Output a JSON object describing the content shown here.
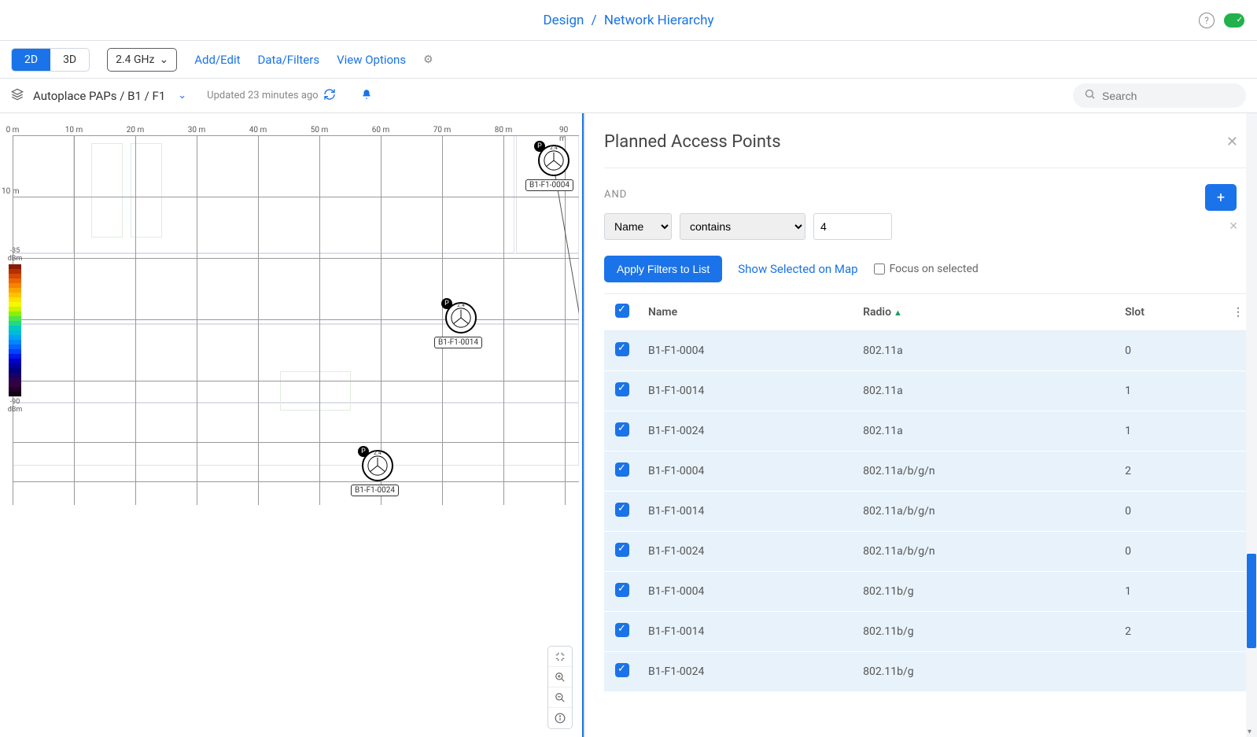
{
  "breadcrumb": {
    "a": "Design",
    "b": "Network Hierarchy"
  },
  "toolbar": {
    "view2d": "2D",
    "view3d": "3D",
    "band": "2.4 GHz",
    "addEdit": "Add/Edit",
    "dataFilters": "Data/Filters",
    "viewOptions": "View Options"
  },
  "subbar": {
    "path": "Autoplace PAPs / B1 / F1",
    "updated": "Updated 23 minutes ago"
  },
  "search": {
    "placeholder": "Search"
  },
  "map": {
    "rulerTop": [
      "0 m",
      "10 m",
      "20 m",
      "30 m",
      "40 m",
      "50 m",
      "60 m",
      "70 m",
      "80 m",
      "90 m"
    ],
    "rulerLeft": [
      "10 m"
    ],
    "legendTop": "-35\ndBm",
    "legendBottom": "-90\ndBm",
    "aps": [
      {
        "label": "B1-F1-0004",
        "band": "2.4"
      },
      {
        "label": "B1-F1-0014",
        "band": "2.4"
      },
      {
        "label": "B1-F1-0024",
        "band": "2.4"
      }
    ]
  },
  "panel": {
    "title": "Planned Access Points",
    "and": "AND",
    "filterField": "Name",
    "filterCond": "contains",
    "filterVal": "4",
    "applyBtn": "Apply Filters to List",
    "showSelected": "Show Selected on Map",
    "focusChk": "Focus on selected",
    "columns": {
      "name": "Name",
      "radio": "Radio",
      "slot": "Slot"
    },
    "rows": [
      {
        "name": "B1-F1-0004",
        "radio": "802.11a",
        "slot": "0"
      },
      {
        "name": "B1-F1-0014",
        "radio": "802.11a",
        "slot": "1"
      },
      {
        "name": "B1-F1-0024",
        "radio": "802.11a",
        "slot": "1"
      },
      {
        "name": "B1-F1-0004",
        "radio": "802.11a/b/g/n",
        "slot": "2"
      },
      {
        "name": "B1-F1-0014",
        "radio": "802.11a/b/g/n",
        "slot": "0"
      },
      {
        "name": "B1-F1-0024",
        "radio": "802.11a/b/g/n",
        "slot": "0"
      },
      {
        "name": "B1-F1-0004",
        "radio": "802.11b/g",
        "slot": "1"
      },
      {
        "name": "B1-F1-0014",
        "radio": "802.11b/g",
        "slot": "2"
      },
      {
        "name": "B1-F1-0024",
        "radio": "802.11b/g",
        "slot": ""
      }
    ]
  }
}
